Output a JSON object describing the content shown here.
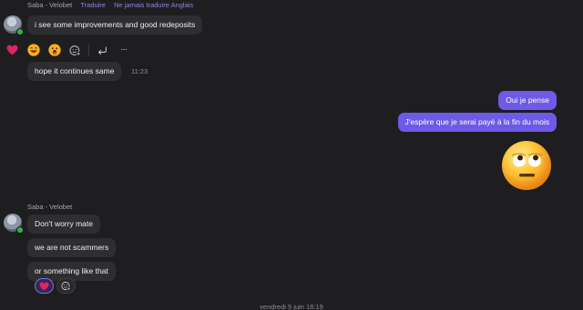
{
  "messages_top": {
    "sender": "Saba - Velobet",
    "translate_link": "Traduire",
    "never_translate_link": "Ne jamais traduire Anglais",
    "message1": "i see some improvements and good redeposits",
    "message2": "hope it continues same",
    "message2_time": "11:23"
  },
  "toolbar": {
    "reactions": [
      "heart-emoji",
      "laughing-emoji",
      "surprised-emoji"
    ],
    "icons": [
      "add-reaction-icon",
      "reply-icon",
      "more-options-icon"
    ],
    "more_label": "···"
  },
  "outgoing": {
    "message1": "Oui je pense",
    "message2": "J'espère que je serai payé à la fin du mois",
    "sticker": "eye-roll-emoji"
  },
  "messages_bottom": {
    "sender": "Saba - Velobet",
    "message1": "Don't worry mate",
    "message2": "we are not scammers",
    "message3": "or something like that",
    "reactions": [
      "heart-emoji",
      "add-reaction-icon"
    ]
  },
  "date_separator": "vendredi 5 juin 16:19",
  "colors": {
    "background": "#1e1e20",
    "incoming_bubble": "#2e2e31",
    "outgoing_bubble": "#6e5ae6",
    "link": "#8d86e6",
    "presence": "#2fb34d"
  }
}
